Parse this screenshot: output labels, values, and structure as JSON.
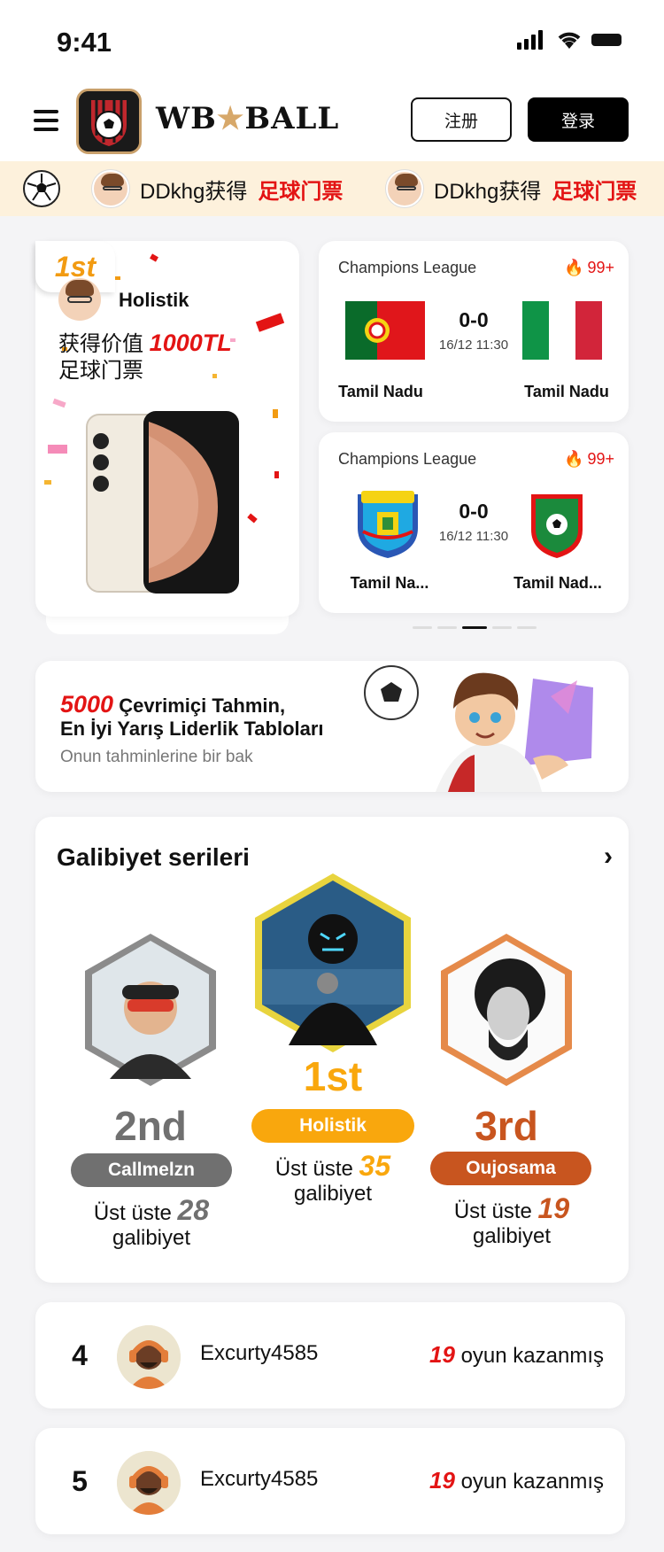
{
  "status": {
    "time": "9:41"
  },
  "header": {
    "logo_left": "WB",
    "logo_star": "★",
    "logo_right": "BALL",
    "register_label": "注册",
    "login_label": "登录"
  },
  "ticker": {
    "items": [
      {
        "user": "DDkhg获得",
        "prize": "足球门票"
      },
      {
        "user": "DDkhg获得",
        "prize": "足球门票"
      }
    ]
  },
  "prize_card": {
    "rank": "1st",
    "user": "Holistik",
    "line1_prefix": "获得价值",
    "amount": "1000TL",
    "line2": "足球门票"
  },
  "matches": [
    {
      "league": "Champions League",
      "hot": "99+",
      "score": "0-0",
      "date": "16/12 11:30",
      "home": "Tamil Nadu",
      "away": "Tamil Nadu"
    },
    {
      "league": "Champions League",
      "hot": "99+",
      "score": "0-0",
      "date": "16/12 11:30",
      "home": "Tamil Na...",
      "away": "Tamil Nad..."
    }
  ],
  "promo": {
    "number": "5000",
    "line1": "Çevrimiçi Tahmin,",
    "line2": "En İyi Yarış Liderlik Tabloları",
    "line3": "Onun tahminlerine bir bak"
  },
  "streak": {
    "title": "Galibiyet serileri",
    "podium": [
      {
        "rank": "2nd",
        "name": "Callmelzn",
        "wins_prefix": "Üst üste",
        "wins": "28",
        "wins_suffix": "galibiyet",
        "color": "#707070"
      },
      {
        "rank": "1st",
        "name": "Holistik",
        "wins_prefix": "Üst üste",
        "wins": "35",
        "wins_suffix": "galibiyet",
        "color": "#f9a70d"
      },
      {
        "rank": "3rd",
        "name": "Oujosama",
        "wins_prefix": "Üst üste",
        "wins": "19",
        "wins_suffix": "galibiyet",
        "color": "#c8551f"
      }
    ]
  },
  "leaders": [
    {
      "rank": "4",
      "name": "Excurty4585",
      "wins": "19",
      "label": "oyun kazanmış"
    },
    {
      "rank": "5",
      "name": "Excurty4585",
      "wins": "19",
      "label": "oyun kazanmış"
    }
  ],
  "colors": {
    "accent_red": "#e31414",
    "gold": "#f9a70d",
    "silver": "#707070",
    "bronze": "#c8551f",
    "ticker_bg": "#fdf1dc"
  }
}
